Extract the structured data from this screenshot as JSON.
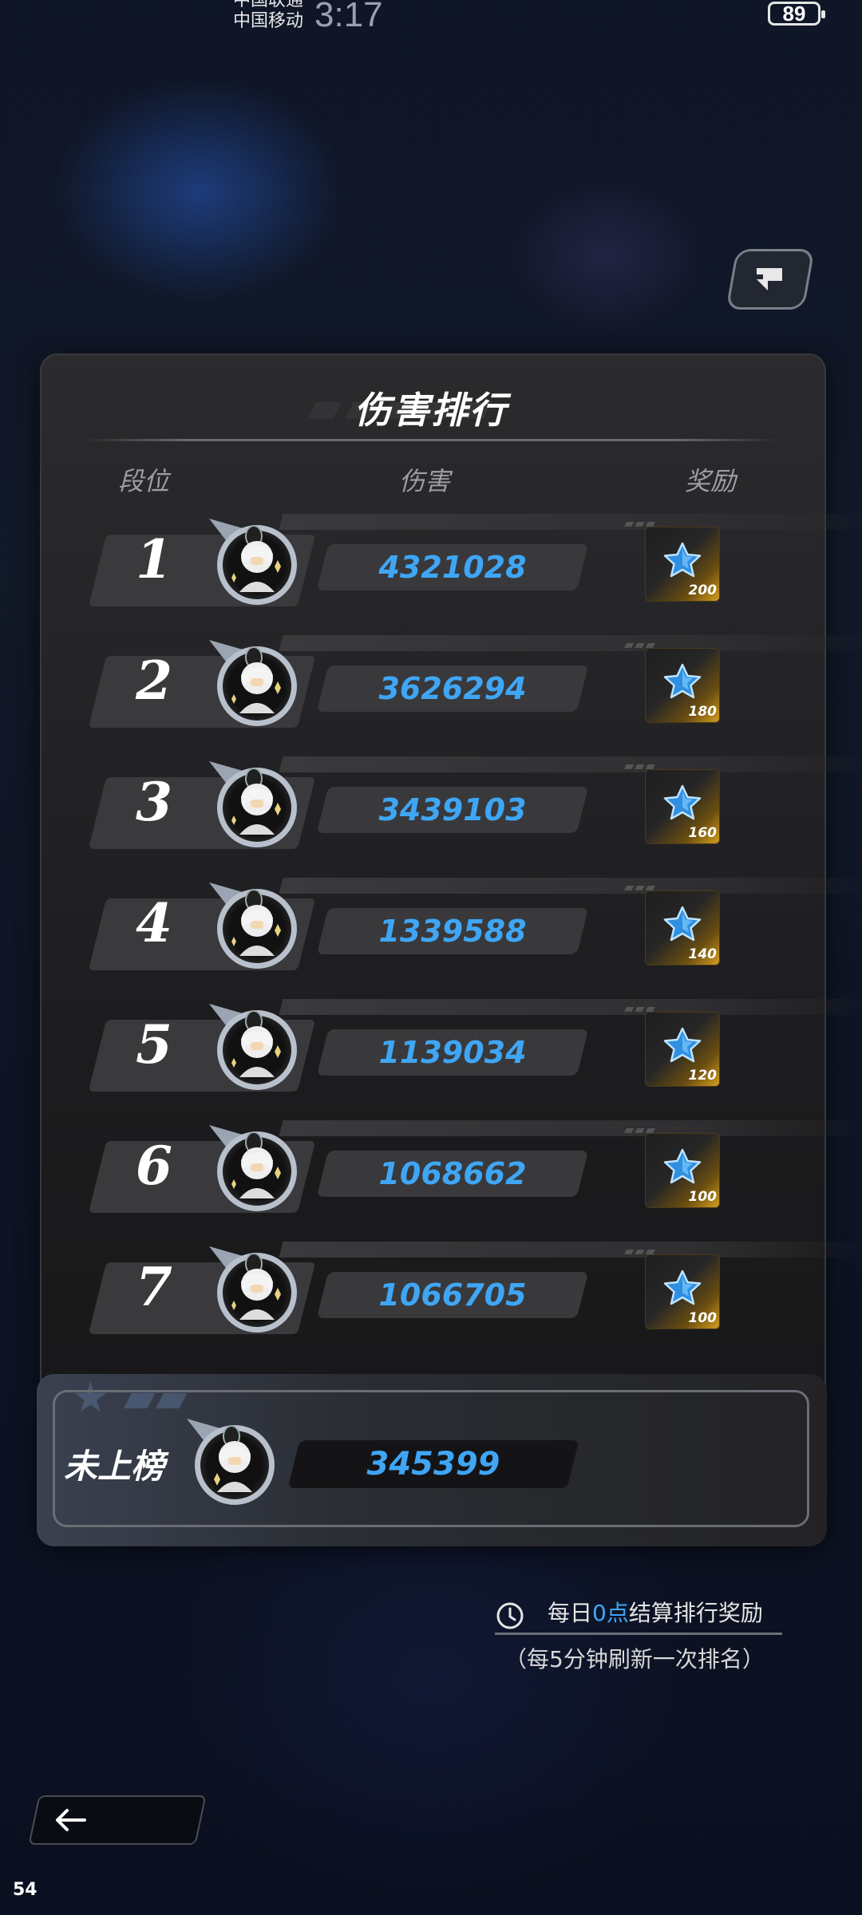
{
  "status_bar": {
    "carrier_1": "中国联通",
    "carrier_2": "中国移动",
    "time": "3:17",
    "battery": "89"
  },
  "panel": {
    "title": "伤害排行",
    "columns": {
      "rank": "段位",
      "damage": "伤害",
      "reward": "奖励"
    }
  },
  "rows": [
    {
      "rank": "1",
      "damage": "4321028",
      "reward_qty": "200"
    },
    {
      "rank": "2",
      "damage": "3626294",
      "reward_qty": "180"
    },
    {
      "rank": "3",
      "damage": "3439103",
      "reward_qty": "160"
    },
    {
      "rank": "4",
      "damage": "1339588",
      "reward_qty": "140"
    },
    {
      "rank": "5",
      "damage": "1139034",
      "reward_qty": "120"
    },
    {
      "rank": "6",
      "damage": "1068662",
      "reward_qty": "100"
    },
    {
      "rank": "7",
      "damage": "1066705",
      "reward_qty": "100"
    }
  ],
  "my_rank": {
    "label": "未上榜",
    "damage": "345399"
  },
  "note": {
    "prefix": "每日",
    "highlight": "0点",
    "suffix": "结算排行奖励",
    "sub": "（每5分钟刷新一次排名）"
  },
  "fps": "54",
  "icons": {
    "share": "share-icon",
    "avatar": "avatar-icon",
    "reward": "blue-star-icon",
    "clock": "clock-icon",
    "back": "back-arrow-icon"
  },
  "colors": {
    "accent_blue": "#3fa6f5",
    "panel_bg": "#1e1e20",
    "reward_gold": "#d9a21e"
  }
}
